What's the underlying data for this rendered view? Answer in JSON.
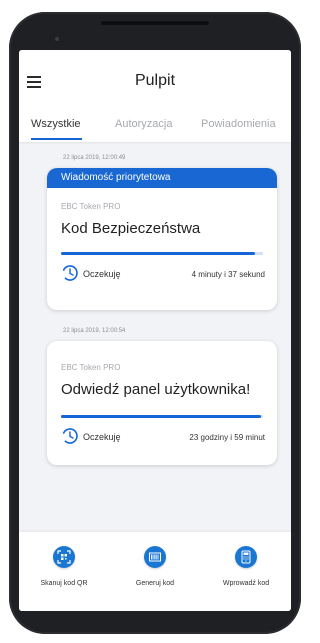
{
  "header": {
    "title": "Pulpit"
  },
  "tabs": [
    {
      "label": "Wszystkie",
      "active": true
    },
    {
      "label": "Autoryzacja",
      "active": false
    },
    {
      "label": "Powiadomienia",
      "active": false
    }
  ],
  "notifications": [
    {
      "date": "22 lipca 2019, 12:00:49",
      "banner": "Wiadomość priorytetowa",
      "source": "EBC Token PRO",
      "title": "Kod Bezpieczeństwa",
      "status": "Oczekuję",
      "remaining": "4 minuty i 37 sekund",
      "progress": 0.96
    },
    {
      "date": "22 lipca 2019, 12:00:54",
      "source": "EBC Token PRO",
      "title": "Odwiedź panel użytkownika!",
      "status": "Oczekuję",
      "remaining": "23 godziny i 59 minut",
      "progress": 0.99
    }
  ],
  "bottom_nav": [
    {
      "label": "Skanuj kod QR",
      "icon": "qr-scan-icon"
    },
    {
      "label": "Generuj kod",
      "icon": "barcode-icon"
    },
    {
      "label": "Wprowadź kod",
      "icon": "keypad-icon"
    }
  ],
  "colors": {
    "accent": "#1565d8",
    "banner": "#1967d2"
  }
}
